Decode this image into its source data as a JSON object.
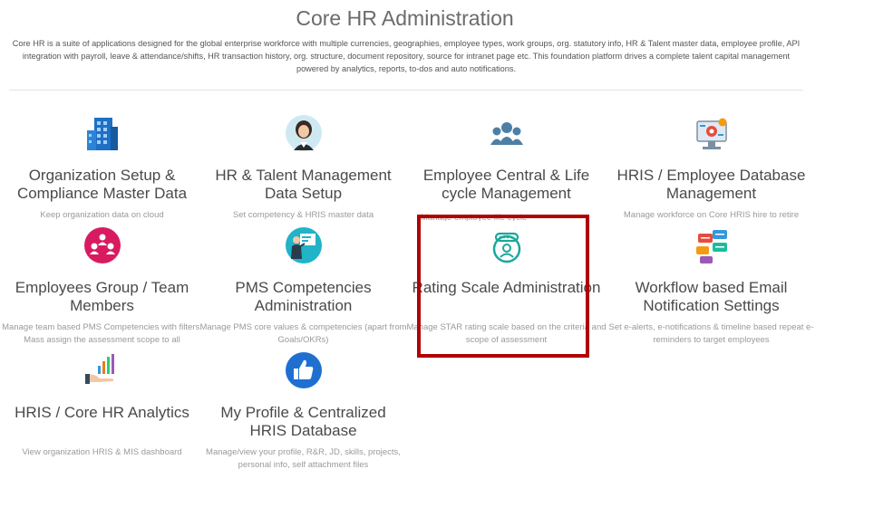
{
  "page": {
    "title": "Core HR Administration",
    "description": "Core HR is a suite of applications designed for the global enterprise workforce with multiple currencies, geographies, employee types, work groups, org. statutory info, HR & Talent master data, employee profile, API integration with payroll, leave & attendance/shifts, HR transaction history, org. structure, document repository, source for intranet page etc. This foundation platform drives a complete talent capital management powered by analytics, reports, to-dos and auto notifications."
  },
  "cards": [
    {
      "icon": "building-icon",
      "title": "Organization Setup & Compliance Master Data",
      "desc": "Keep organization data on cloud"
    },
    {
      "icon": "female-avatar-icon",
      "title": "HR & Talent Management Data Setup",
      "desc": "Set competency & HRIS master data"
    },
    {
      "icon": "people-group-icon",
      "title": "Employee Central & Life cycle Management",
      "desc": "Manage employee life cycle"
    },
    {
      "icon": "database-monitor-icon",
      "title": "HRIS / Employee Database Management",
      "desc": "Manage workforce on Core HRIS hire to retire"
    },
    {
      "icon": "team-circle-icon",
      "title": "Employees Group / Team Members",
      "desc": "Manage team based PMS Competencies with filters. Mass assign the assessment scope to all"
    },
    {
      "icon": "presenter-icon",
      "title": "PMS Competencies Administration",
      "desc": "Manage PMS core values & competencies (apart from Goals/OKRs)"
    },
    {
      "icon": "rating-badge-icon",
      "title": "Rating Scale Administration",
      "desc": "Manage STAR rating scale based on the criteria and scope of assessment"
    },
    {
      "icon": "chat-bubbles-icon",
      "title": "Workflow based Email Notification Settings",
      "desc": "Set e-alerts, e-notifications & timeline based repeat e-reminders to target employees"
    },
    {
      "icon": "analytics-hand-icon",
      "title": "HRIS / Core HR Analytics",
      "desc": "View organization HRIS & MIS dashboard"
    },
    {
      "icon": "thumbs-up-icon",
      "title": "My Profile & Centralized HRIS Database",
      "desc": "Manage/view your profile, R&R, JD, skills, projects, personal info, self attachment files"
    }
  ],
  "colors": {
    "highlight_border": "#b00000",
    "title_text": "#4a4a4a",
    "desc_text": "#9a9a9a"
  }
}
